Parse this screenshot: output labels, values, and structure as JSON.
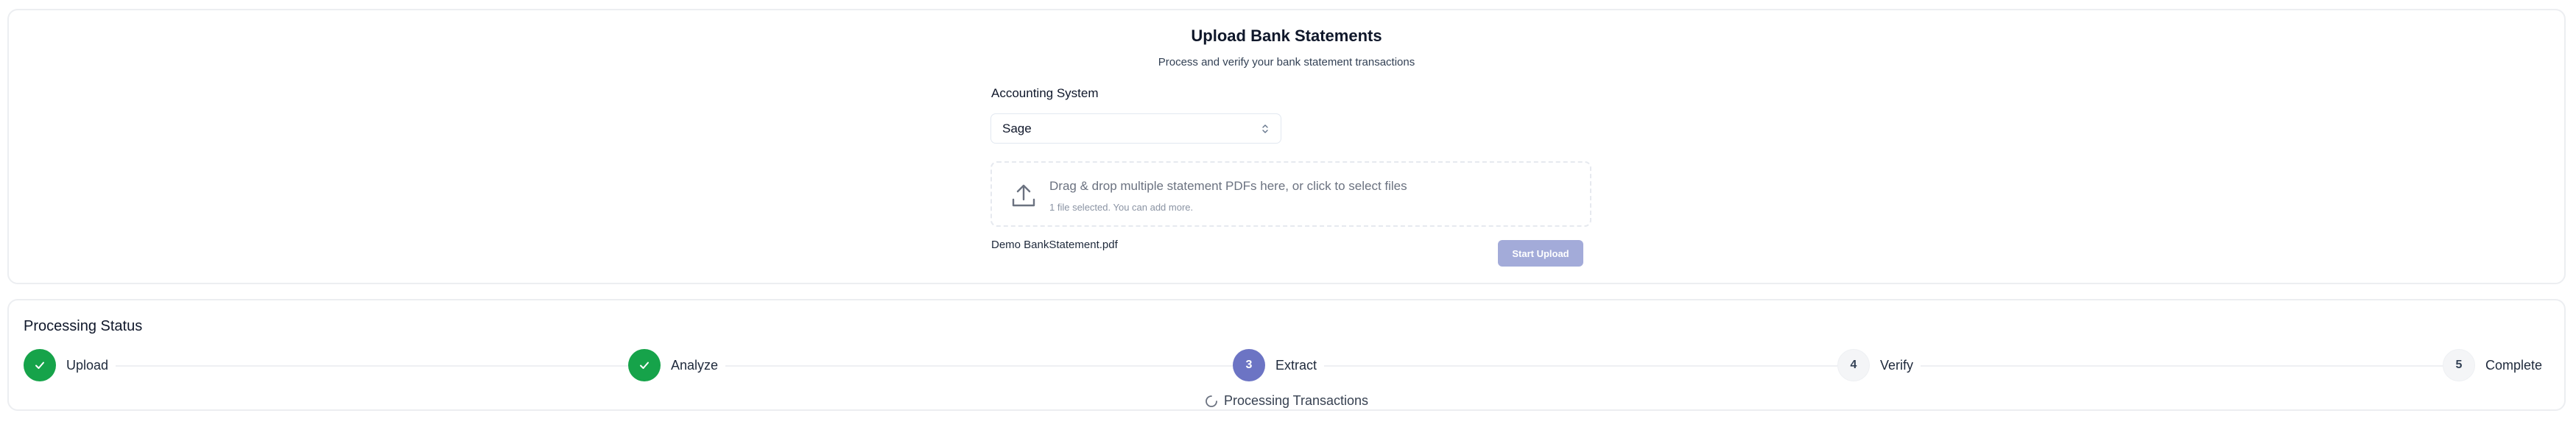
{
  "upload": {
    "title": "Upload Bank Statements",
    "subtitle": "Process and verify your bank statement transactions",
    "accounting_label": "Accounting System",
    "accounting_value": "Sage",
    "dropzone_text": "Drag & drop multiple statement PDFs here, or click to select files",
    "dropzone_subtext": "1 file selected. You can add more.",
    "file_name": "Demo BankStatement.pdf",
    "start_button": "Start Upload"
  },
  "status": {
    "title": "Processing Status",
    "steps": [
      {
        "number": "1",
        "label": "Upload",
        "state": "done"
      },
      {
        "number": "2",
        "label": "Analyze",
        "state": "done"
      },
      {
        "number": "3",
        "label": "Extract",
        "state": "active"
      },
      {
        "number": "4",
        "label": "Verify",
        "state": "pending"
      },
      {
        "number": "5",
        "label": "Complete",
        "state": "pending"
      }
    ],
    "processing_text": "Processing Transactions"
  },
  "colors": {
    "done": "#16a34a",
    "active": "#6c74c4",
    "button_disabled": "#a3abd9"
  }
}
